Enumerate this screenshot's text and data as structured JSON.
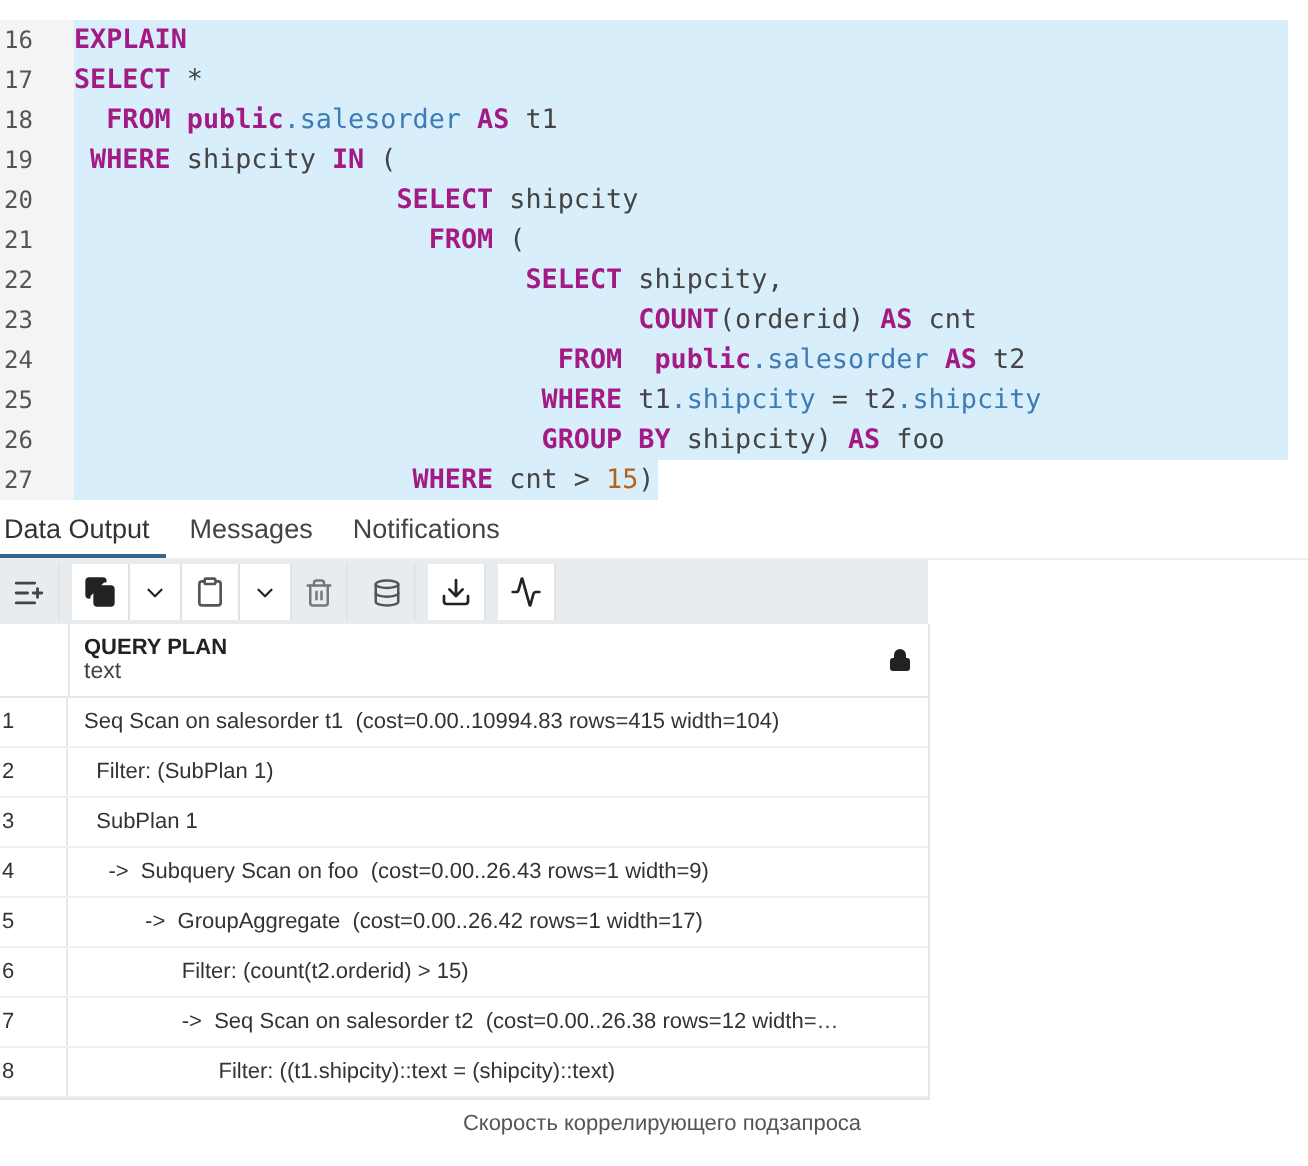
{
  "editor": {
    "lines": [
      {
        "number": "16",
        "selected": true,
        "tokens": [
          {
            "kind": "keyword",
            "text": "EXPLAIN"
          }
        ]
      },
      {
        "number": "17",
        "selected": true,
        "tokens": [
          {
            "kind": "keyword",
            "text": "SELECT"
          },
          {
            "kind": "plain",
            "text": " *"
          }
        ]
      },
      {
        "number": "18",
        "selected": true,
        "tokens": [
          {
            "kind": "keyword",
            "text": "  FROM"
          },
          {
            "kind": "keyword",
            "text": " public"
          },
          {
            "kind": "ident",
            "text": ".salesorder"
          },
          {
            "kind": "keyword",
            "text": " AS"
          },
          {
            "kind": "plain",
            "text": " t1"
          }
        ]
      },
      {
        "number": "19",
        "selected": true,
        "tokens": [
          {
            "kind": "keyword",
            "text": " WHERE"
          },
          {
            "kind": "plain",
            "text": " shipcity "
          },
          {
            "kind": "keyword",
            "text": "IN"
          },
          {
            "kind": "plain",
            "text": " ("
          }
        ]
      },
      {
        "number": "20",
        "selected": true,
        "tokens": [
          {
            "kind": "keyword",
            "text": "                    SELECT"
          },
          {
            "kind": "plain",
            "text": " shipcity"
          }
        ]
      },
      {
        "number": "21",
        "selected": true,
        "tokens": [
          {
            "kind": "keyword",
            "text": "                      FROM"
          },
          {
            "kind": "plain",
            "text": " ("
          }
        ]
      },
      {
        "number": "22",
        "selected": true,
        "tokens": [
          {
            "kind": "keyword",
            "text": "                            SELECT"
          },
          {
            "kind": "plain",
            "text": " shipcity,"
          }
        ]
      },
      {
        "number": "23",
        "selected": true,
        "tokens": [
          {
            "kind": "keyword",
            "text": "                                   COUNT"
          },
          {
            "kind": "plain",
            "text": "(orderid) "
          },
          {
            "kind": "keyword",
            "text": "AS"
          },
          {
            "kind": "plain",
            "text": " cnt"
          }
        ]
      },
      {
        "number": "24",
        "selected": true,
        "tokens": [
          {
            "kind": "keyword",
            "text": "                              FROM"
          },
          {
            "kind": "keyword",
            "text": "  public"
          },
          {
            "kind": "ident",
            "text": ".salesorder"
          },
          {
            "kind": "keyword",
            "text": " AS"
          },
          {
            "kind": "plain",
            "text": " t2"
          }
        ]
      },
      {
        "number": "25",
        "selected": true,
        "tokens": [
          {
            "kind": "keyword",
            "text": "                             WHERE"
          },
          {
            "kind": "plain",
            "text": " t1"
          },
          {
            "kind": "ident",
            "text": ".shipcity"
          },
          {
            "kind": "plain",
            "text": " = t2"
          },
          {
            "kind": "ident",
            "text": ".shipcity"
          }
        ]
      },
      {
        "number": "26",
        "selected": true,
        "tokens": [
          {
            "kind": "keyword",
            "text": "                             GROUP BY"
          },
          {
            "kind": "plain",
            "text": " shipcity) "
          },
          {
            "kind": "keyword",
            "text": "AS"
          },
          {
            "kind": "plain",
            "text": " foo"
          }
        ]
      },
      {
        "number": "27",
        "selected": true,
        "tokens": [
          {
            "kind": "keyword",
            "text": "                     WHERE"
          },
          {
            "kind": "plain",
            "text": " cnt > "
          },
          {
            "kind": "number",
            "text": "15"
          },
          {
            "kind": "plain",
            "text": ")"
          }
        ]
      }
    ]
  },
  "tabs": [
    {
      "label": "Data Output",
      "selected": true
    },
    {
      "label": "Messages",
      "selected": false
    },
    {
      "label": "Notifications",
      "selected": false
    }
  ],
  "grid": {
    "column": {
      "title": "QUERY PLAN",
      "type": "text"
    },
    "rows": [
      {
        "number": "1",
        "text": "Seq Scan on salesorder t1  (cost=0.00..10994.83 rows=415 width=104)"
      },
      {
        "number": "2",
        "text": "  Filter: (SubPlan 1)"
      },
      {
        "number": "3",
        "text": "  SubPlan 1"
      },
      {
        "number": "4",
        "text": "    ->  Subquery Scan on foo  (cost=0.00..26.43 rows=1 width=9)"
      },
      {
        "number": "5",
        "text": "          ->  GroupAggregate  (cost=0.00..26.42 rows=1 width=17)"
      },
      {
        "number": "6",
        "text": "                Filter: (count(t2.orderid) > 15)"
      },
      {
        "number": "7",
        "text": "                ->  Seq Scan on salesorder t2  (cost=0.00..26.38 rows=12 width=…"
      },
      {
        "number": "8",
        "text": "                      Filter: ((t1.shipcity)::text = (shipcity)::text)"
      }
    ]
  },
  "caption": "Скорость коррелирующего подзапроса"
}
